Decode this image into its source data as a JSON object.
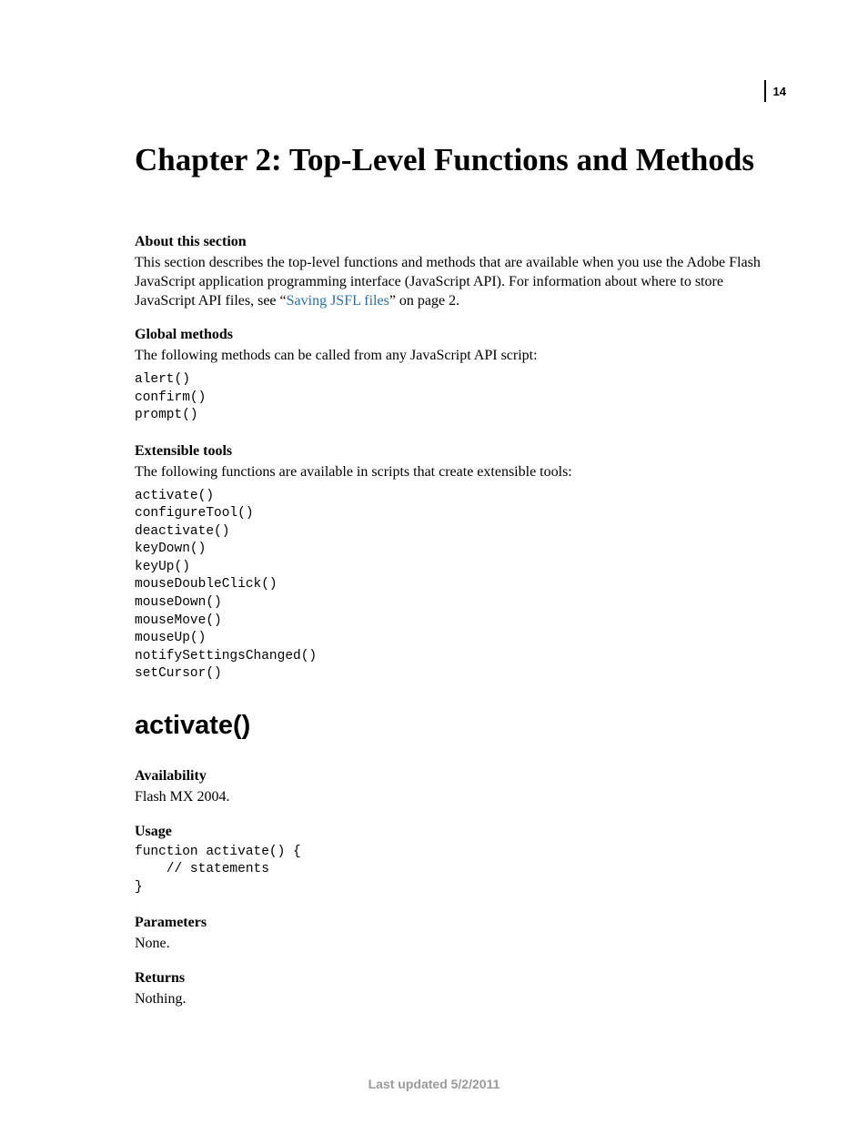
{
  "page_number": "14",
  "chapter_title": "Chapter 2: Top-Level Functions and Methods",
  "about": {
    "heading": "About this section",
    "body_before_link": "This section describes the top-level functions and methods that are available when you use the Adobe Flash JavaScript application programming interface (JavaScript API). For information about where to store JavaScript API files, see “",
    "link_text": "Saving JSFL files",
    "body_after_link": "” on page 2."
  },
  "global_methods": {
    "heading": "Global methods",
    "body": "The following methods can be called from any JavaScript API script:",
    "code": "alert()\nconfirm()\nprompt()"
  },
  "extensible_tools": {
    "heading": "Extensible tools",
    "body": "The following functions are available in scripts that create extensible tools:",
    "code": "activate()\nconfigureTool()\ndeactivate()\nkeyDown()\nkeyUp()\nmouseDoubleClick()\nmouseDown()\nmouseMove()\nmouseUp()\nnotifySettingsChanged()\nsetCursor()"
  },
  "function": {
    "name": "activate()",
    "availability": {
      "heading": "Availability",
      "body": "Flash MX 2004."
    },
    "usage": {
      "heading": "Usage",
      "code": "function activate() {\n    // statements\n}"
    },
    "parameters": {
      "heading": "Parameters",
      "body": "None."
    },
    "returns": {
      "heading": "Returns",
      "body": "Nothing."
    }
  },
  "footer": "Last updated 5/2/2011"
}
